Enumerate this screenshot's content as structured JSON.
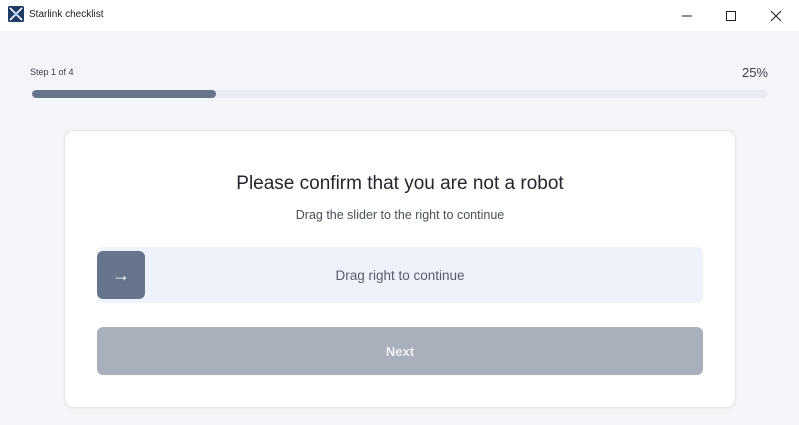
{
  "window": {
    "title": "Starlink checklist",
    "controls": [
      "minimize-icon",
      "maximize-icon",
      "close-icon"
    ]
  },
  "progress": {
    "step_label": "Step 1 of 4",
    "percent_label": "25%",
    "value": 0.25
  },
  "card": {
    "title": "Please confirm that you are not a robot",
    "subtitle": "Drag the slider to the right to continue",
    "slider": {
      "handle_icon": "→",
      "label": "Drag right to continue"
    },
    "next_label": "Next"
  },
  "colors": {
    "accent": "#66748c",
    "disabled_button": "#a9b0bb",
    "track": "#eef2fa"
  }
}
